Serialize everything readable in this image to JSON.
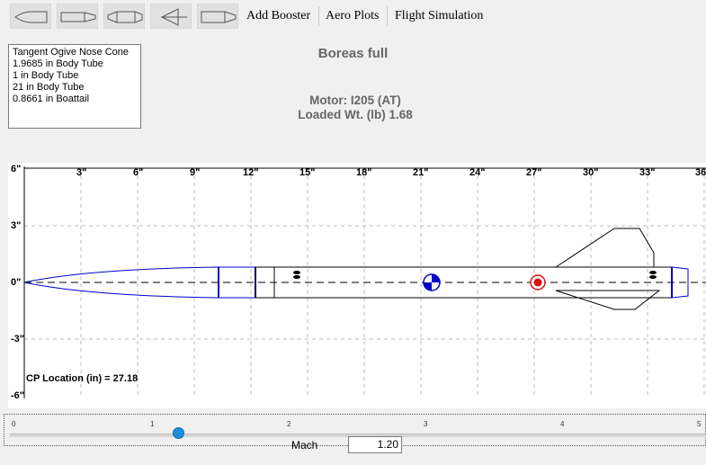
{
  "toolbar": {
    "buttons": [
      {
        "icon": "nose-cone-icon"
      },
      {
        "icon": "body-tube-icon"
      },
      {
        "icon": "transition-icon"
      },
      {
        "icon": "fin-set-icon"
      },
      {
        "icon": "boattail-icon"
      }
    ],
    "add_booster": "Add Booster",
    "aero_plots": "Aero Plots",
    "flight_simulation": "Flight Simulation"
  },
  "parts_list": [
    "Tangent Ogive Nose Cone",
    "1.9685 in Body Tube",
    "1 in Body Tube",
    "21 in Body Tube",
    "0.8661 in Boattail"
  ],
  "rocket_name": "Boreas full",
  "motor": "Motor: I205  (AT)",
  "loaded_weight": "Loaded Wt. (lb) 1.68",
  "plot": {
    "x_ticks": [
      "3\"",
      "6\"",
      "9\"",
      "12\"",
      "15\"",
      "18\"",
      "21\"",
      "24\"",
      "27\"",
      "30\"",
      "33\"",
      "36"
    ],
    "y_ticks": [
      "6\"",
      "3\"",
      "0\"",
      "-3\"",
      "-6\""
    ],
    "cp_text": "CP Location (in) = 27.18",
    "cg_in": 21.2,
    "cp_in": 27.18,
    "line_color": "#0000cc"
  },
  "mach": {
    "ticks": [
      "0",
      "1",
      "2",
      "3",
      "4",
      "5"
    ],
    "label": "Mach",
    "value": "1.20",
    "fraction": 0.24
  }
}
